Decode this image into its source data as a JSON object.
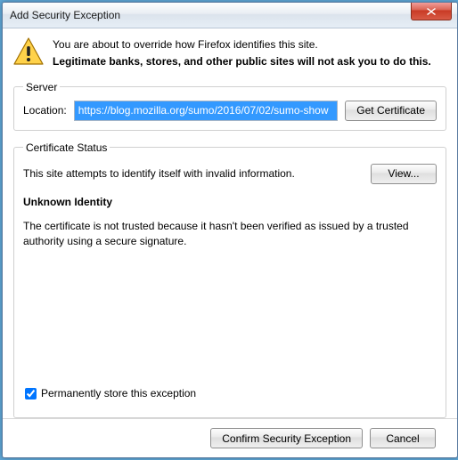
{
  "window": {
    "title": "Add Security Exception"
  },
  "intro": {
    "line1": "You are about to override how Firefox identifies this site.",
    "line2": "Legitimate banks, stores, and other public sites will not ask you to do this."
  },
  "server": {
    "legend": "Server",
    "location_label": "Location:",
    "location_value": "https://blog.mozilla.org/sumo/2016/07/02/sumo-show",
    "get_cert": "Get Certificate"
  },
  "cert": {
    "legend": "Certificate Status",
    "status_line": "This site attempts to identify itself with invalid information.",
    "view": "View...",
    "unknown_heading": "Unknown Identity",
    "explain": "The certificate is not trusted because it hasn't been verified as issued by a trusted authority using a secure signature."
  },
  "store": {
    "label": "Permanently store this exception",
    "checked": true
  },
  "buttons": {
    "confirm": "Confirm Security Exception",
    "cancel": "Cancel"
  }
}
